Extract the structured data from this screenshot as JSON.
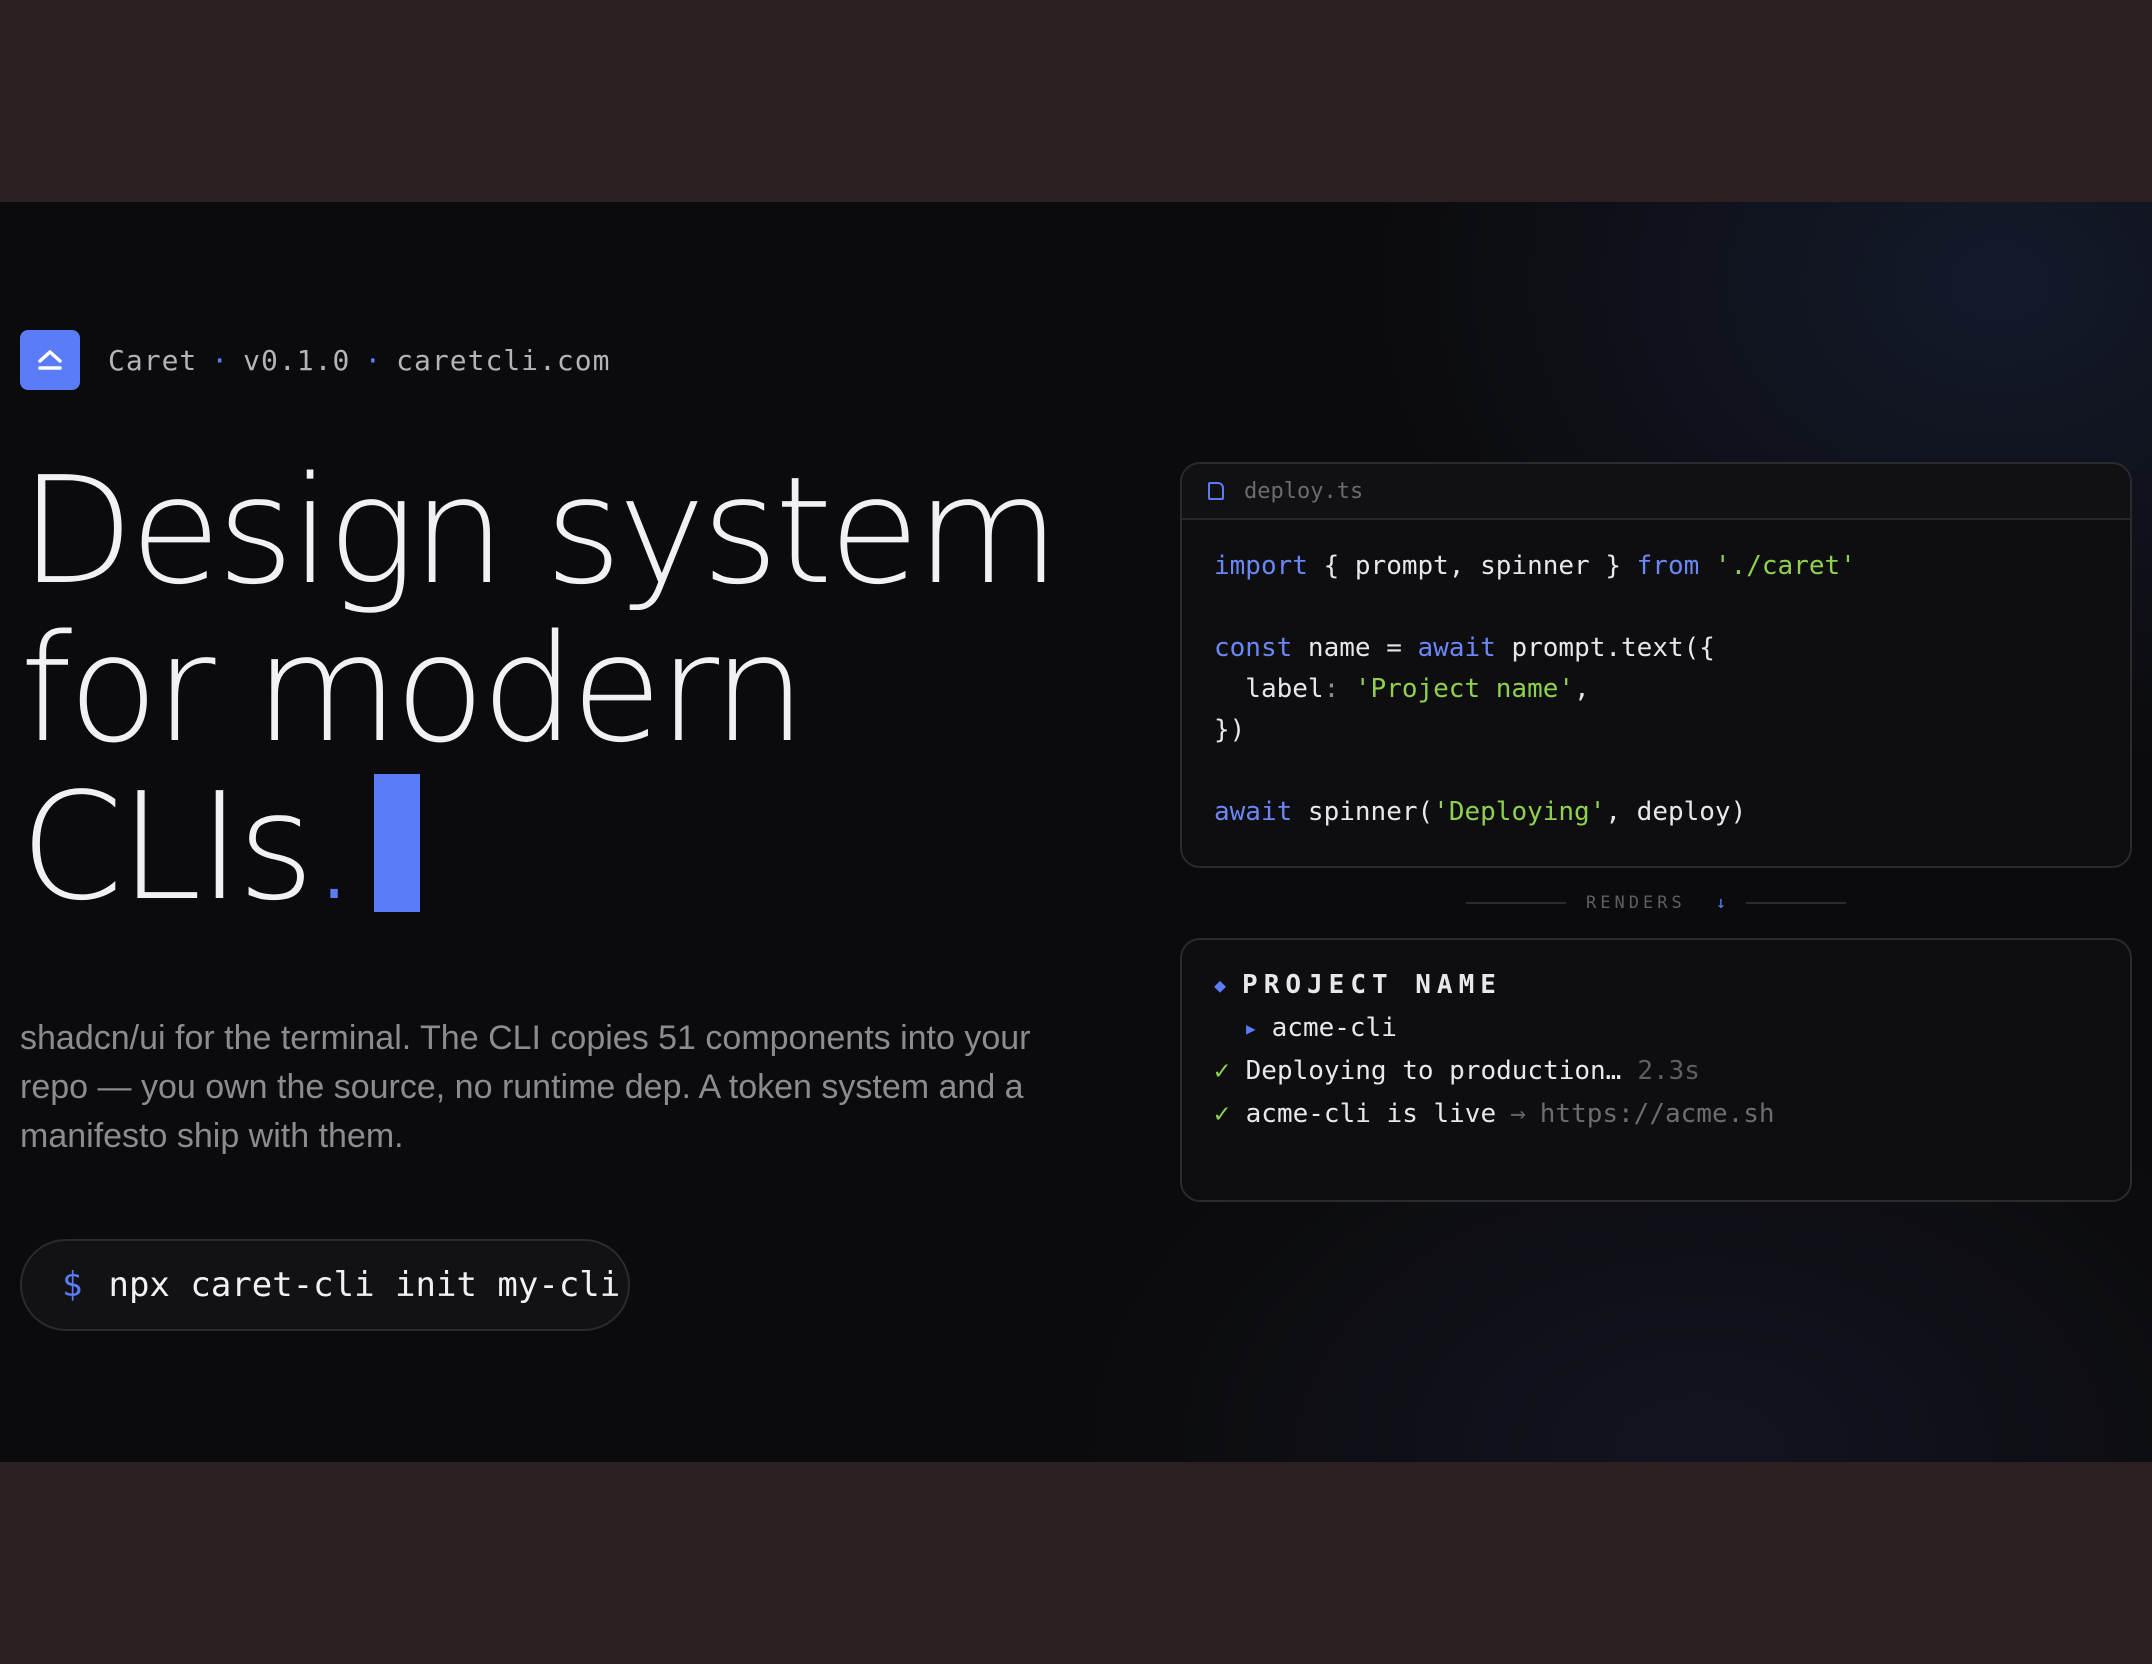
{
  "brand": {
    "name": "Caret",
    "version": "v0.1.0",
    "site": "caretcli.com",
    "logo_icon": "eject-icon",
    "accent": "#5b7cf7"
  },
  "hero": {
    "line1": "Design system",
    "line2": "for modern",
    "line3": "CLIs",
    "period": "."
  },
  "description": "shadcn/ui for the terminal. The CLI copies 51 components into your repo — you own the source, no runtime dep. A token system and a manifesto ship with them.",
  "command": {
    "prompt": "$",
    "text": "npx caret-cli init my-cli"
  },
  "code_card": {
    "filename": "deploy.ts",
    "lines": {
      "l1_import": "import",
      "l1_mid": " { prompt, spinner } ",
      "l1_from": "from",
      "l1_path": " './caret'",
      "l3_const": "const",
      "l3_mid": " name = ",
      "l3_await": "await",
      "l3_call": " prompt.text({",
      "l4_key": "  label",
      "l4_colon": ": ",
      "l4_val": "'Project name'",
      "l4_comma": ",",
      "l5": "})",
      "l7_await": "await",
      "l7_call": " spinner(",
      "l7_str": "'Deploying'",
      "l7_end": ", deploy)"
    }
  },
  "renders_label": "RENDERS",
  "renders_arrow": "↓",
  "terminal": {
    "prompt_title": "PROJECT NAME",
    "answer": "acme-cli",
    "status1_text": "Deploying to production…",
    "status1_time": "2.3s",
    "status2_text": "acme-cli is live",
    "status2_arrow": "→",
    "status2_url": "https://acme.sh",
    "check_color": "#8fd14f"
  }
}
